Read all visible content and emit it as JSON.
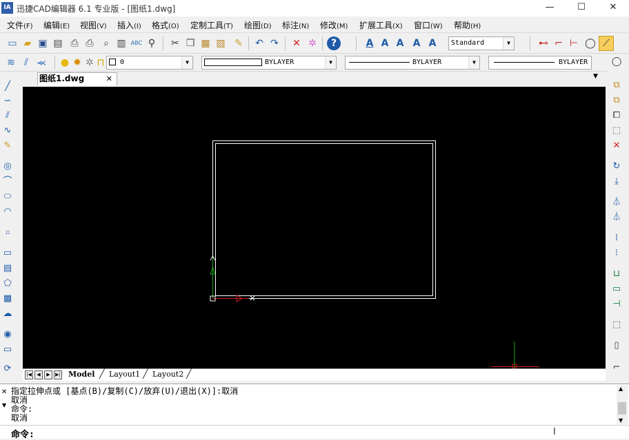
{
  "window": {
    "title": "迅捷CAD编辑器 6.1 专业版  - [图纸1.dwg]",
    "logo_text": "IA",
    "min_glyph": "—",
    "max_glyph": "☐",
    "close_glyph": "✕"
  },
  "menu": [
    {
      "label": "文件",
      "hotkey": "(F)"
    },
    {
      "label": "编辑",
      "hotkey": "(E)"
    },
    {
      "label": "视图",
      "hotkey": "(V)"
    },
    {
      "label": "插入",
      "hotkey": "(I)"
    },
    {
      "label": "格式",
      "hotkey": "(O)"
    },
    {
      "label": "定制工具",
      "hotkey": "(T)"
    },
    {
      "label": "绘图",
      "hotkey": "(D)"
    },
    {
      "label": "标注",
      "hotkey": "(N)"
    },
    {
      "label": "修改",
      "hotkey": "(M)"
    },
    {
      "label": "扩展工具",
      "hotkey": "(X)"
    },
    {
      "label": "窗口",
      "hotkey": "(W)"
    },
    {
      "label": "帮助",
      "hotkey": "(H)"
    }
  ],
  "toolbar": {
    "text_style": "Standard",
    "layer": "0",
    "color": "BYLAYER",
    "linetype": "BYLAYER",
    "lineweight": "BYLAYER"
  },
  "document": {
    "tab_label": "图纸1.dwg",
    "close_glyph": "✕",
    "tab_menu_glyph": "▼"
  },
  "layouts": {
    "tabs": [
      "Model",
      "Layout1",
      "Layout2"
    ],
    "active": "Model"
  },
  "command": {
    "history": [
      "指定拉伸点或 [基点(B)/复制(C)/放弃(U)/退出(X)]:取消",
      "取消",
      "命令:",
      "取消"
    ],
    "prompt": "命令:"
  },
  "colors": {
    "canvas": "#000000",
    "drawing_line": "#ffffff",
    "ucs_x": "#d11f1f",
    "ucs_y": "#1fa31f",
    "icon_blue": "#1e5aa8"
  }
}
